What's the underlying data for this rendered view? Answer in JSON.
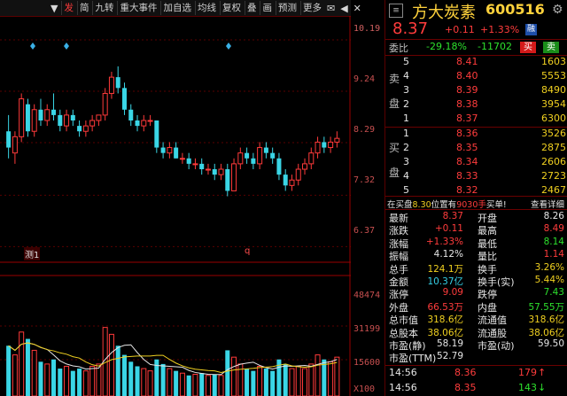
{
  "toolbar": {
    "buttons": [
      "发",
      "简",
      "九转",
      "重大事件",
      "加自选",
      "均线",
      "复权",
      "叠",
      "画",
      "预测",
      "更多"
    ],
    "right_icons": [
      "email-icon",
      "arrow-left-icon",
      "close-icon"
    ]
  },
  "chart": {
    "price_axis": [
      "10.19",
      "9.24",
      "8.29",
      "7.32",
      "6.37"
    ],
    "vol_axis": [
      "48474",
      "31199",
      "15600"
    ],
    "vol_unit": "X100",
    "markers": [
      "测1",
      "q"
    ],
    "candles": [
      {
        "o": 8.5,
        "h": 8.8,
        "l": 8.0,
        "c": 8.2
      },
      {
        "o": 8.1,
        "h": 8.5,
        "l": 7.9,
        "c": 8.4
      },
      {
        "o": 8.4,
        "h": 9.2,
        "l": 8.3,
        "c": 9.1
      },
      {
        "o": 9.0,
        "h": 9.1,
        "l": 8.4,
        "c": 8.5
      },
      {
        "o": 8.5,
        "h": 9.0,
        "l": 8.4,
        "c": 8.9
      },
      {
        "o": 8.9,
        "h": 9.1,
        "l": 8.6,
        "c": 8.7
      },
      {
        "o": 8.7,
        "h": 9.0,
        "l": 8.6,
        "c": 8.9
      },
      {
        "o": 8.9,
        "h": 9.2,
        "l": 8.7,
        "c": 8.8
      },
      {
        "o": 8.8,
        "h": 8.9,
        "l": 8.5,
        "c": 8.6
      },
      {
        "o": 8.6,
        "h": 8.9,
        "l": 8.5,
        "c": 8.8
      },
      {
        "o": 8.8,
        "h": 8.9,
        "l": 8.6,
        "c": 8.7
      },
      {
        "o": 8.6,
        "h": 8.7,
        "l": 8.4,
        "c": 8.5
      },
      {
        "o": 8.5,
        "h": 8.7,
        "l": 8.4,
        "c": 8.6
      },
      {
        "o": 8.6,
        "h": 8.8,
        "l": 8.5,
        "c": 8.7
      },
      {
        "o": 8.7,
        "h": 8.8,
        "l": 8.6,
        "c": 8.8
      },
      {
        "o": 8.8,
        "h": 9.3,
        "l": 8.7,
        "c": 9.2
      },
      {
        "o": 9.2,
        "h": 9.6,
        "l": 9.1,
        "c": 9.5
      },
      {
        "o": 9.5,
        "h": 9.7,
        "l": 9.2,
        "c": 9.3
      },
      {
        "o": 9.3,
        "h": 9.4,
        "l": 8.8,
        "c": 8.9
      },
      {
        "o": 8.9,
        "h": 9.0,
        "l": 8.6,
        "c": 8.7
      },
      {
        "o": 8.7,
        "h": 8.8,
        "l": 8.5,
        "c": 8.6
      },
      {
        "o": 8.6,
        "h": 8.8,
        "l": 8.5,
        "c": 8.7
      },
      {
        "o": 8.7,
        "h": 8.8,
        "l": 8.6,
        "c": 8.7
      },
      {
        "o": 8.7,
        "h": 8.7,
        "l": 8.1,
        "c": 8.2
      },
      {
        "o": 8.2,
        "h": 8.3,
        "l": 8.0,
        "c": 8.1
      },
      {
        "o": 8.1,
        "h": 8.3,
        "l": 8.0,
        "c": 8.2
      },
      {
        "o": 8.2,
        "h": 8.3,
        "l": 8.0,
        "c": 8.0
      },
      {
        "o": 8.0,
        "h": 8.1,
        "l": 7.9,
        "c": 8.0
      },
      {
        "o": 8.0,
        "h": 8.1,
        "l": 7.8,
        "c": 7.9
      },
      {
        "o": 7.9,
        "h": 8.0,
        "l": 7.8,
        "c": 7.9
      },
      {
        "o": 7.9,
        "h": 8.0,
        "l": 7.7,
        "c": 7.8
      },
      {
        "o": 7.8,
        "h": 7.9,
        "l": 7.7,
        "c": 7.8
      },
      {
        "o": 7.8,
        "h": 7.9,
        "l": 7.6,
        "c": 7.7
      },
      {
        "o": 7.7,
        "h": 7.9,
        "l": 7.6,
        "c": 7.8
      },
      {
        "o": 7.8,
        "h": 7.9,
        "l": 7.3,
        "c": 7.4
      },
      {
        "o": 7.4,
        "h": 8.0,
        "l": 7.4,
        "c": 7.9
      },
      {
        "o": 7.9,
        "h": 8.2,
        "l": 7.8,
        "c": 8.1
      },
      {
        "o": 8.1,
        "h": 8.2,
        "l": 7.9,
        "c": 8.0
      },
      {
        "o": 8.0,
        "h": 8.1,
        "l": 7.8,
        "c": 7.9
      },
      {
        "o": 7.9,
        "h": 8.3,
        "l": 7.8,
        "c": 8.2
      },
      {
        "o": 8.2,
        "h": 8.3,
        "l": 8.0,
        "c": 8.1
      },
      {
        "o": 8.1,
        "h": 8.2,
        "l": 7.9,
        "c": 8.0
      },
      {
        "o": 8.0,
        "h": 8.1,
        "l": 7.6,
        "c": 7.7
      },
      {
        "o": 7.7,
        "h": 7.8,
        "l": 7.4,
        "c": 7.5
      },
      {
        "o": 7.5,
        "h": 7.7,
        "l": 7.4,
        "c": 7.6
      },
      {
        "o": 7.6,
        "h": 7.9,
        "l": 7.5,
        "c": 7.8
      },
      {
        "o": 7.8,
        "h": 8.0,
        "l": 7.7,
        "c": 7.9
      },
      {
        "o": 7.9,
        "h": 8.2,
        "l": 7.8,
        "c": 8.1
      },
      {
        "o": 8.1,
        "h": 8.4,
        "l": 8.0,
        "c": 8.3
      },
      {
        "o": 8.3,
        "h": 8.4,
        "l": 8.1,
        "c": 8.2
      },
      {
        "o": 8.2,
        "h": 8.4,
        "l": 8.1,
        "c": 8.3
      },
      {
        "o": 8.3,
        "h": 8.5,
        "l": 8.2,
        "c": 8.37
      }
    ],
    "volumes": [
      22000,
      18000,
      28000,
      25000,
      20000,
      15000,
      14000,
      16000,
      12000,
      13000,
      11000,
      12000,
      11000,
      13000,
      14000,
      30000,
      27000,
      22000,
      18000,
      15000,
      13000,
      12000,
      11000,
      16000,
      14000,
      12000,
      11000,
      10000,
      9000,
      9500,
      10000,
      9000,
      9500,
      9000,
      20000,
      17000,
      14000,
      12000,
      11000,
      13000,
      12000,
      11000,
      16000,
      14000,
      12000,
      13000,
      12000,
      14000,
      18000,
      16000,
      15000,
      17000
    ]
  },
  "quote": {
    "name": "方大炭素",
    "code": "600516",
    "price": "8.37",
    "change": "+0.11",
    "change_pct": "+1.33%",
    "market_badge": "融",
    "settings_icon": "gear-icon",
    "weibi_label": "委比",
    "weibi_pct": "-29.18%",
    "weicha": "-11702",
    "buy_btn": "买",
    "sell_btn": "卖"
  },
  "sell_orders": [
    {
      "level": "5",
      "price": "8.41",
      "vol": "1603"
    },
    {
      "level": "4",
      "price": "8.40",
      "vol": "5553"
    },
    {
      "level": "3",
      "price": "8.39",
      "vol": "8490"
    },
    {
      "level": "2",
      "price": "8.38",
      "vol": "3954"
    },
    {
      "level": "1",
      "price": "8.37",
      "vol": "6300"
    }
  ],
  "sell_side_label": [
    "卖",
    "盘"
  ],
  "buy_orders": [
    {
      "level": "1",
      "price": "8.36",
      "vol": "3526"
    },
    {
      "level": "2",
      "price": "8.35",
      "vol": "2875"
    },
    {
      "level": "3",
      "price": "8.34",
      "vol": "2606"
    },
    {
      "level": "4",
      "price": "8.33",
      "vol": "2723"
    },
    {
      "level": "5",
      "price": "8.32",
      "vol": "2467"
    }
  ],
  "buy_side_label": [
    "买",
    "盘"
  ],
  "notice": {
    "prefix": "在买盘",
    "price": "8.30",
    "mid": "位置有",
    "qty": "9030手",
    "suffix": "买单!",
    "link": "查看详细"
  },
  "stats_left": [
    {
      "label": "最新",
      "value": "8.37",
      "cls": "red"
    },
    {
      "label": "涨跌",
      "value": "+0.11",
      "cls": "red"
    },
    {
      "label": "涨幅",
      "value": "+1.33%",
      "cls": "red"
    },
    {
      "label": "振幅",
      "value": "4.12%",
      "cls": "white"
    },
    {
      "label": "总手",
      "value": "124.1万",
      "cls": "yellow"
    },
    {
      "label": "金额",
      "value": "10.37亿",
      "cls": "cyan"
    },
    {
      "label": "涨停",
      "value": "9.09",
      "cls": "red"
    },
    {
      "label": "外盘",
      "value": "66.53万",
      "cls": "red"
    },
    {
      "label": "总市值",
      "value": "318.6亿",
      "cls": "yellow"
    },
    {
      "label": "总股本",
      "value": "38.06亿",
      "cls": "yellow"
    },
    {
      "label": "市盈(静)",
      "value": "58.19",
      "cls": "white"
    },
    {
      "label": "市盈(TTM)",
      "value": "52.79",
      "cls": "white"
    }
  ],
  "stats_right": [
    {
      "label": "开盘",
      "value": "8.26",
      "cls": "white"
    },
    {
      "label": "最高",
      "value": "8.49",
      "cls": "red"
    },
    {
      "label": "最低",
      "value": "8.14",
      "cls": "green"
    },
    {
      "label": "量比",
      "value": "1.14",
      "cls": "red"
    },
    {
      "label": "换手",
      "value": "3.26%",
      "cls": "yellow"
    },
    {
      "label": "换手(实)",
      "value": "5.44%",
      "cls": "yellow"
    },
    {
      "label": "跌停",
      "value": "7.43",
      "cls": "green"
    },
    {
      "label": "内盘",
      "value": "57.55万",
      "cls": "green"
    },
    {
      "label": "流通值",
      "value": "318.6亿",
      "cls": "yellow"
    },
    {
      "label": "流通股",
      "value": "38.06亿",
      "cls": "yellow"
    },
    {
      "label": "市盈(动)",
      "value": "59.50",
      "cls": "white"
    },
    {
      "label": "",
      "value": "",
      "cls": "white"
    }
  ],
  "ticks": [
    {
      "time": "14:56",
      "price": "8.36",
      "vol": "179",
      "dir": "↑",
      "cls": "red"
    },
    {
      "time": "14:56",
      "price": "8.35",
      "vol": "143",
      "dir": "↓",
      "cls": "green"
    }
  ]
}
